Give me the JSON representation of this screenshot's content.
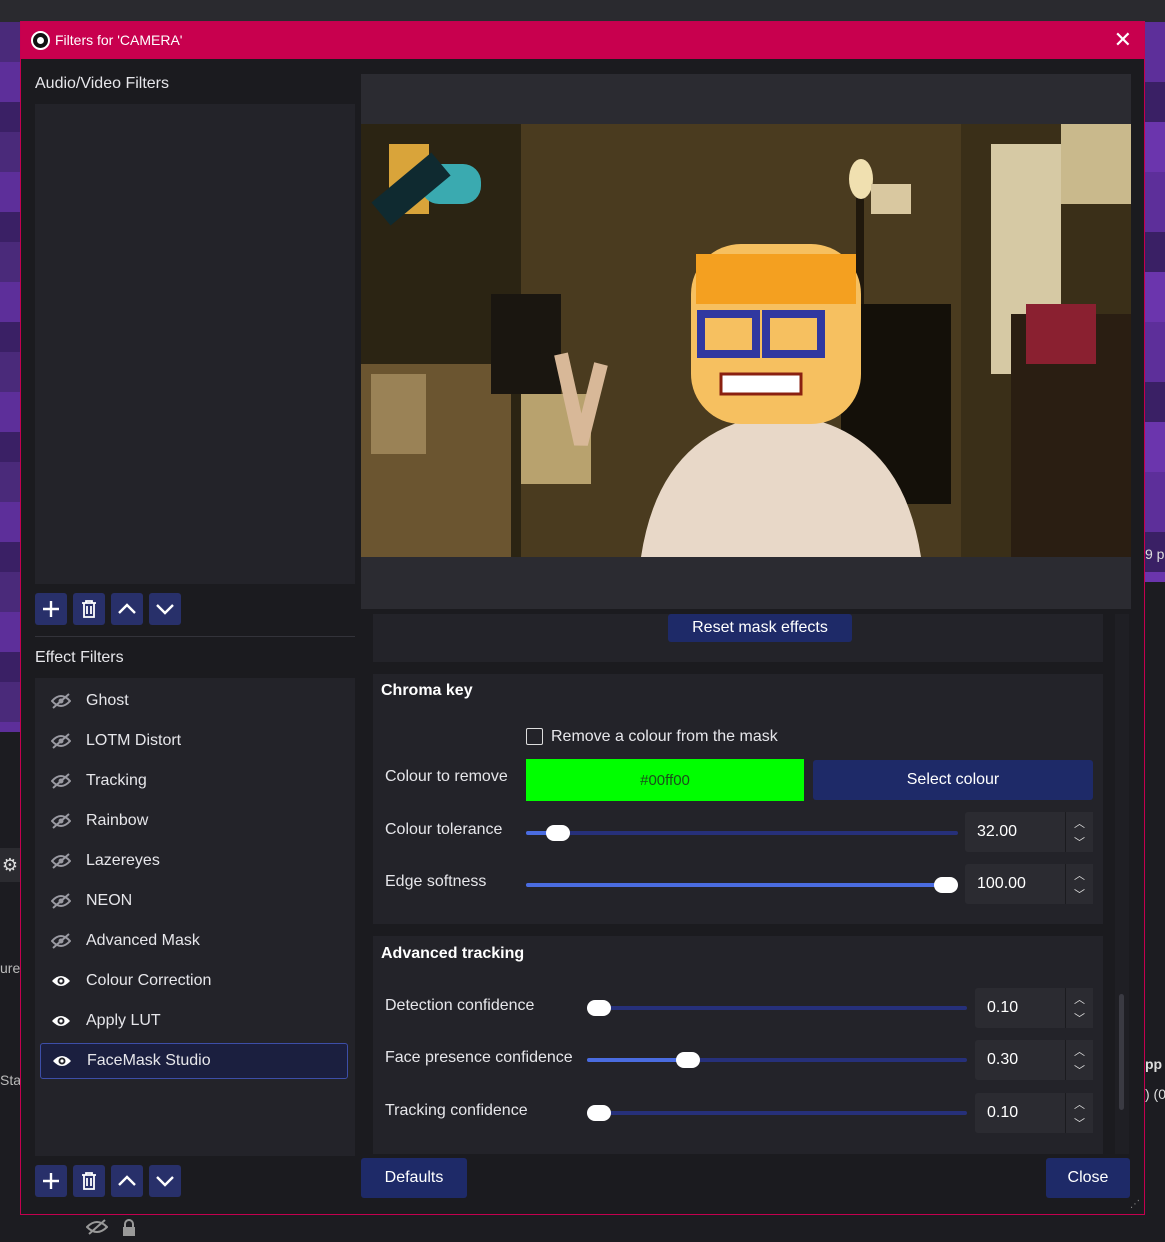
{
  "dialog": {
    "title": "Filters for 'CAMERA'"
  },
  "audio_video": {
    "title": "Audio/Video Filters"
  },
  "effects": {
    "title": "Effect Filters",
    "items": [
      {
        "label": "Ghost",
        "visible": false
      },
      {
        "label": "LOTM Distort",
        "visible": false
      },
      {
        "label": "Tracking",
        "visible": false
      },
      {
        "label": "Rainbow",
        "visible": false
      },
      {
        "label": "Lazereyes",
        "visible": false
      },
      {
        "label": "NEON",
        "visible": false
      },
      {
        "label": "Advanced Mask",
        "visible": false
      },
      {
        "label": "Colour Correction",
        "visible": true
      },
      {
        "label": "Apply LUT",
        "visible": true
      },
      {
        "label": "FaceMask Studio",
        "visible": true,
        "selected": true
      }
    ]
  },
  "props": {
    "reset_mask": "Reset mask effects",
    "chroma": {
      "title": "Chroma key",
      "remove_checkbox": "Remove a colour from the mask",
      "colour_label": "Colour to remove",
      "colour_value": "#00ff00",
      "colour_hex": "#00ff00",
      "select_colour": "Select colour",
      "tolerance_label": "Colour tolerance",
      "tolerance_value": "32.00",
      "tolerance_level": 0.05,
      "softness_label": "Edge softness",
      "softness_value": "100.00",
      "softness_level": 1.0
    },
    "tracking": {
      "title": "Advanced tracking",
      "detection_label": "Detection confidence",
      "detection_value": "0.10",
      "detection_level": 0.0,
      "presence_label": "Face presence confidence",
      "presence_value": "0.30",
      "presence_level": 0.25,
      "tracking_label": "Tracking confidence",
      "tracking_value": "0.10",
      "tracking_level": 0.0
    }
  },
  "footer": {
    "defaults": "Defaults",
    "close": "Close"
  },
  "background": {
    "left_text_1": "ure",
    "left_text_2": "Sta",
    "right_text_1": "9 p",
    "right_text_2": "pp",
    "right_text_3": ") (0"
  }
}
